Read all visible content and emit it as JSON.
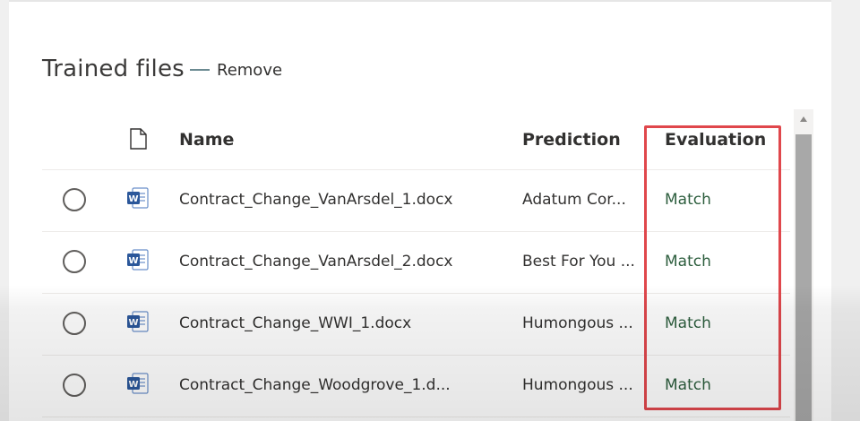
{
  "section": {
    "title": "Trained files",
    "remove_label": "Remove"
  },
  "table": {
    "columns": {
      "file_type_icon": "document-icon",
      "name": "Name",
      "prediction": "Prediction",
      "evaluation": "Evaluation"
    },
    "rows": [
      {
        "name": "Contract_Change_VanArsdel_1.docx",
        "prediction": "Adatum Cor...",
        "evaluation": "Match",
        "icon": "word-doc-icon"
      },
      {
        "name": "Contract_Change_VanArsdel_2.docx",
        "prediction": "Best For You ...",
        "evaluation": "Match",
        "icon": "word-doc-icon"
      },
      {
        "name": "Contract_Change_WWI_1.docx",
        "prediction": "Humongous ...",
        "evaluation": "Match",
        "icon": "word-doc-icon"
      },
      {
        "name": "Contract_Change_Woodgrove_1.d...",
        "prediction": "Humongous ...",
        "evaluation": "Match",
        "icon": "word-doc-icon"
      }
    ]
  },
  "colors": {
    "match": "#2d5e3e",
    "highlight": "#e0474c",
    "word_blue": "#2b579a"
  }
}
